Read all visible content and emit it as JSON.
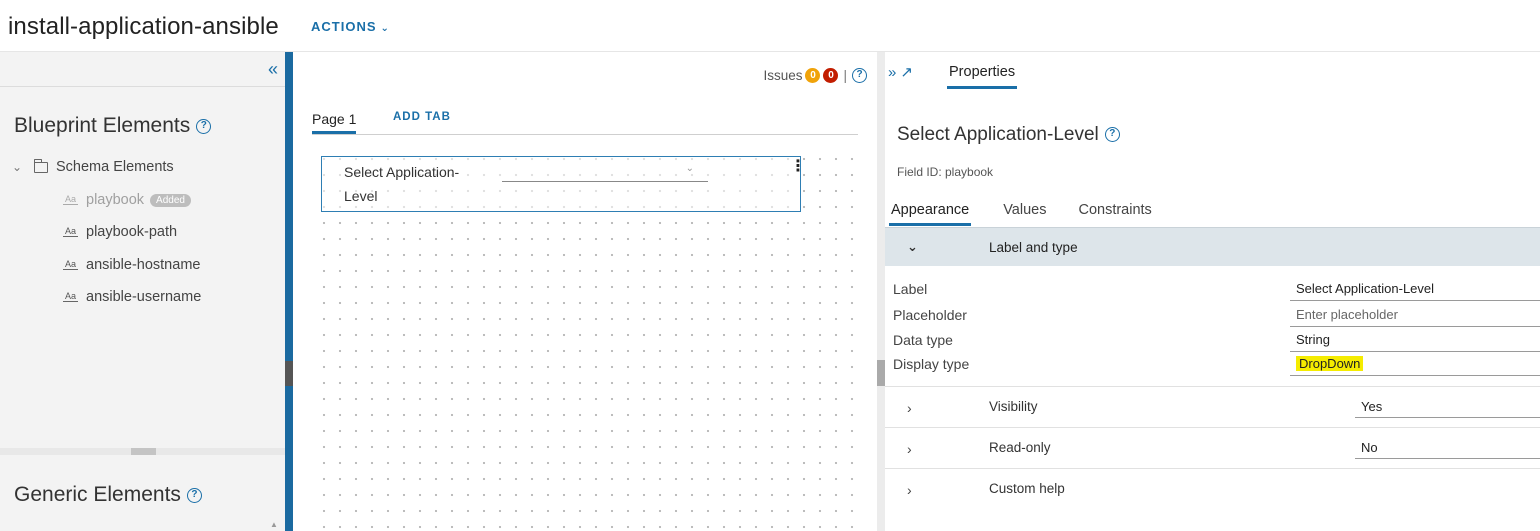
{
  "header": {
    "title": "install-application-ansible",
    "actions_label": "ACTIONS",
    "actions_icon": "chevron-down-icon"
  },
  "left_panel": {
    "collapse_icon": "double-chevron-left-icon",
    "blueprint_title": "Blueprint Elements",
    "schema_group": "Schema Elements",
    "schema_items": [
      {
        "label": "playbook",
        "badge": "Added",
        "dimmed": true
      },
      {
        "label": "playbook-path"
      },
      {
        "label": "ansible-hostname"
      },
      {
        "label": "ansible-username"
      }
    ],
    "generic_title": "Generic Elements"
  },
  "canvas": {
    "issues_label": "Issues",
    "warnings_count": "0",
    "errors_count": "0",
    "tabs": [
      {
        "label": "Page 1",
        "active": true
      },
      {
        "label": "ADD TAB"
      }
    ],
    "field": {
      "label_line1": "Select Application-",
      "label_line2": "Level",
      "menu_icon": "vertical-ellipsis-icon"
    }
  },
  "properties": {
    "tab_label": "Properties",
    "title": "Select Application-Level",
    "field_id": "Field ID: playbook",
    "sub_tabs": [
      "Appearance",
      "Values",
      "Constraints"
    ],
    "label_and_type": {
      "title": "Label and type",
      "rows": [
        {
          "label": "Label",
          "value": "Select Application-Level"
        },
        {
          "label": "Placeholder",
          "value": "Enter placeholder"
        },
        {
          "label": "Data type",
          "value": "String"
        },
        {
          "label": "Display type",
          "value": "DropDown"
        }
      ]
    },
    "sections": [
      {
        "title": "Visibility",
        "value": "Yes"
      },
      {
        "title": "Read-only",
        "value": "No"
      },
      {
        "title": "Custom help",
        "value": ""
      }
    ]
  },
  "colors": {
    "accent": "#1a6fa8",
    "warning": "#f0a30a",
    "error": "#c21d00",
    "highlight": "#f5ec00"
  }
}
